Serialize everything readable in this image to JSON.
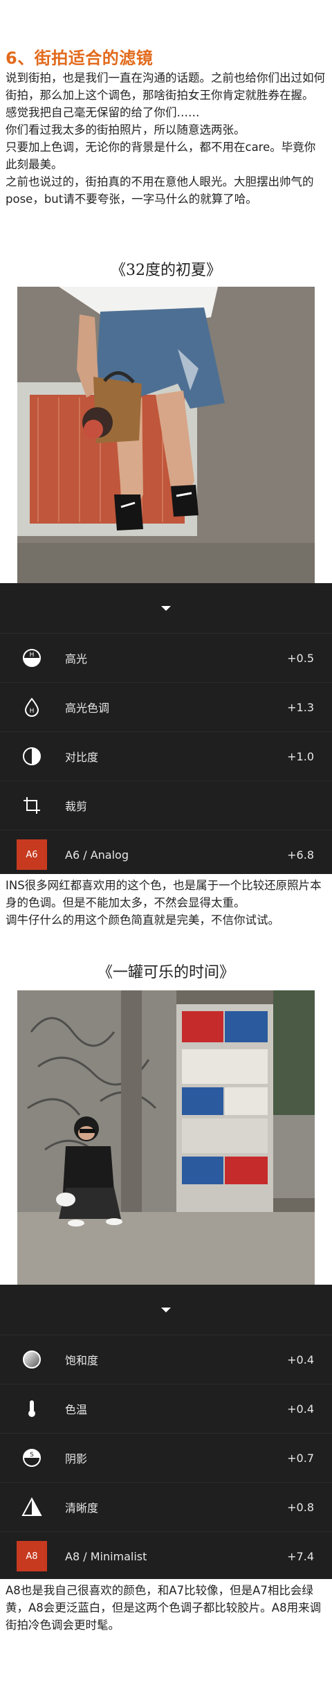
{
  "section": {
    "title": "6、街拍适合的滤镜",
    "intro": [
      "说到街拍，也是我们一直在沟通的话题。之前也给你们出过如何街拍，那么加上这个调色，那啥街拍女王你肯定就胜券在握。",
      "感觉我把自己毫无保留的给了你们……",
      "你们看过我太多的街拍照片，所以随意选两张。",
      "只要加上色调，无论你的背景是什么，都不用在care。毕竟你此刻最美。",
      "之前也说过的，街拍真的不用在意他人眼光。大胆摆出帅气的pose，but请不要夸张，一字马什么的就算了哈。"
    ]
  },
  "filter1": {
    "caption": "《32度的初夏》",
    "adjustments": [
      {
        "name": "高光",
        "value": "+0.5",
        "icon": "highlight-icon"
      },
      {
        "name": "高光色调",
        "value": "+1.3",
        "icon": "highlight-tint-icon"
      },
      {
        "name": "对比度",
        "value": "+1.0",
        "icon": "contrast-icon"
      },
      {
        "name": "裁剪",
        "value": "",
        "icon": "crop-icon"
      }
    ],
    "preset": {
      "chip": "A6",
      "name": "A6 / Analog",
      "value": "+6.8"
    },
    "description": [
      "INS很多网红都喜欢用的这个色，也是属于一个比较还原照片本身的色调。但是不能加太多，不然会显得太重。",
      "调牛仔什么的用这个颜色简直就是完美，不信你试试。"
    ]
  },
  "filter2": {
    "caption": "《一罐可乐的时间》",
    "adjustments": [
      {
        "name": "饱和度",
        "value": "+0.4",
        "icon": "saturation-icon"
      },
      {
        "name": "色温",
        "value": "+0.4",
        "icon": "temperature-icon"
      },
      {
        "name": "阴影",
        "value": "+0.7",
        "icon": "shadow-icon"
      },
      {
        "name": "清晰度",
        "value": "+0.8",
        "icon": "clarity-icon"
      }
    ],
    "preset": {
      "chip": "A8",
      "name": "A8 / Minimalist",
      "value": "+7.4"
    },
    "description": [
      "A8也是我自己很喜欢的颜色，和A7比较像，但是A7相比会绿黄，A8会更泛蓝白，但是这两个色调子都比较胶片。A8用来调街拍冷色调会更时髦。"
    ]
  },
  "colors": {
    "accent_orange": "#e26a1b",
    "panel_bg": "#1f1f1f",
    "preset_red": "#c73a20"
  }
}
